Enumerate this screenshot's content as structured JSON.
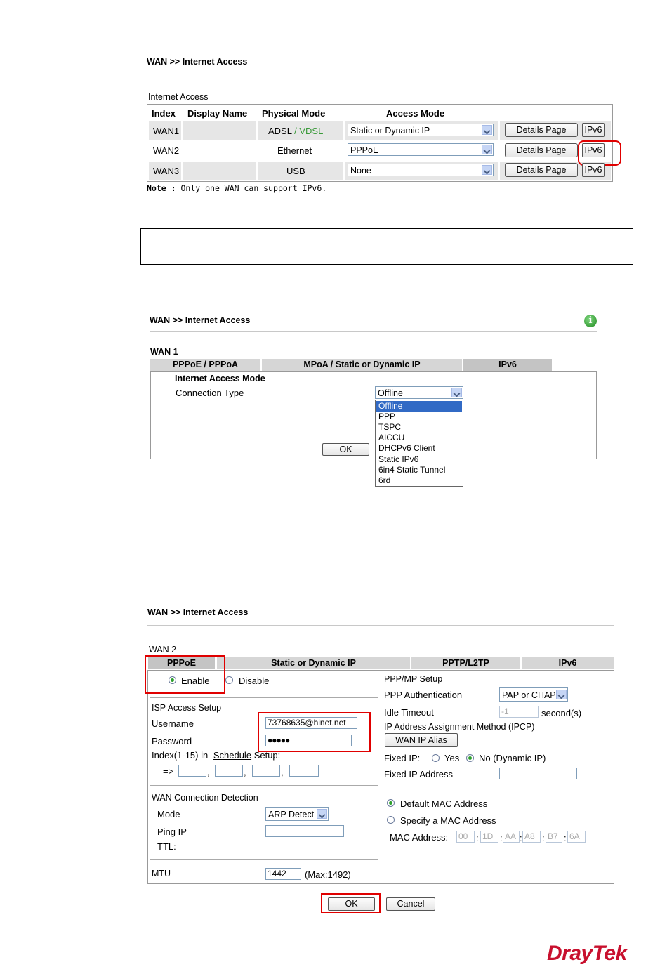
{
  "section1": {
    "breadcrumb": "WAN >> Internet Access",
    "table_title": "Internet Access",
    "columns": [
      "Index",
      "Display Name",
      "Physical Mode",
      "Access Mode"
    ],
    "rows": [
      {
        "index": "WAN1",
        "display_name": "",
        "physical_a": "ADSL",
        "physical_sep": "/",
        "physical_b": "VDSL",
        "access_mode": "Static or Dynamic IP",
        "details_label": "Details Page",
        "ipv6_label": "IPv6"
      },
      {
        "index": "WAN2",
        "display_name": "",
        "physical_a": "Ethernet",
        "access_mode": "PPPoE",
        "details_label": "Details Page",
        "ipv6_label": "IPv6"
      },
      {
        "index": "WAN3",
        "display_name": "",
        "physical_a": "USB",
        "access_mode": "None",
        "details_label": "Details Page",
        "ipv6_label": "IPv6"
      }
    ],
    "note_label": "Note :",
    "note_text": "Only one WAN can support IPv6."
  },
  "section2": {
    "breadcrumb": "WAN >> Internet Access",
    "wan_title": "WAN 1",
    "tabs": [
      "PPPoE / PPPoA",
      "MPoA / Static or Dynamic IP",
      "IPv6"
    ],
    "mode_heading": "Internet Access Mode",
    "connection_type_label": "Connection Type",
    "connection_type_value": "Offline",
    "dropdown_options": [
      "Offline",
      "PPP",
      "TSPC",
      "AICCU",
      "DHCPv6 Client",
      "Static IPv6",
      "6in4 Static Tunnel",
      "6rd"
    ],
    "ok_label": "OK"
  },
  "section3": {
    "breadcrumb": "WAN >> Internet Access",
    "wan_title": "WAN 2",
    "tabs": [
      "PPPoE",
      "Static or Dynamic IP",
      "PPTP/L2TP",
      "IPv6"
    ],
    "enable_label": "Enable",
    "disable_label": "Disable",
    "isp_heading": "ISP Access Setup",
    "username_label": "Username",
    "username_value": "73768635@hinet.net",
    "password_label": "Password",
    "password_value": "●●●●●",
    "index_label_a": "Index(1-15) in",
    "schedule_link": "Schedule",
    "index_label_b": "Setup:",
    "arrow_label": "=>",
    "detection_heading": "WAN Connection Detection",
    "mode_label": "Mode",
    "mode_value": "ARP Detect",
    "ping_label": "Ping IP",
    "ttl_label": "TTL:",
    "mtu_label": "MTU",
    "mtu_value": "1442",
    "mtu_max": "(Max:1492)",
    "ppp_heading": "PPP/MP Setup",
    "ppp_auth_label": "PPP Authentication",
    "ppp_auth_value": "PAP or CHAP",
    "idle_label": "Idle Timeout",
    "idle_value": "-1",
    "idle_unit": "second(s)",
    "ipcp_heading": "IP Address Assignment Method (IPCP)",
    "alias_button": "WAN IP Alias",
    "fixed_ip_label": "Fixed IP:",
    "yes_label": "Yes",
    "no_label": "No (Dynamic IP)",
    "fixed_addr_label": "Fixed IP Address",
    "default_mac_label": "Default MAC Address",
    "specify_mac_label": "Specify a MAC Address",
    "mac_label": "MAC Address:",
    "mac_parts": [
      "00",
      "1D",
      "AA",
      "A8",
      "B7",
      "6A"
    ],
    "ok_label": "OK",
    "cancel_label": "Cancel"
  },
  "logo": {
    "brand_a": "Dray",
    "brand_b": "Tek"
  },
  "colors": {
    "highlight": "#e00000",
    "vdsl_green": "#3a9a3a",
    "logo_red": "#c8102e",
    "tab_gray": "#d6d6d6",
    "selected_blue": "#316ac5"
  }
}
